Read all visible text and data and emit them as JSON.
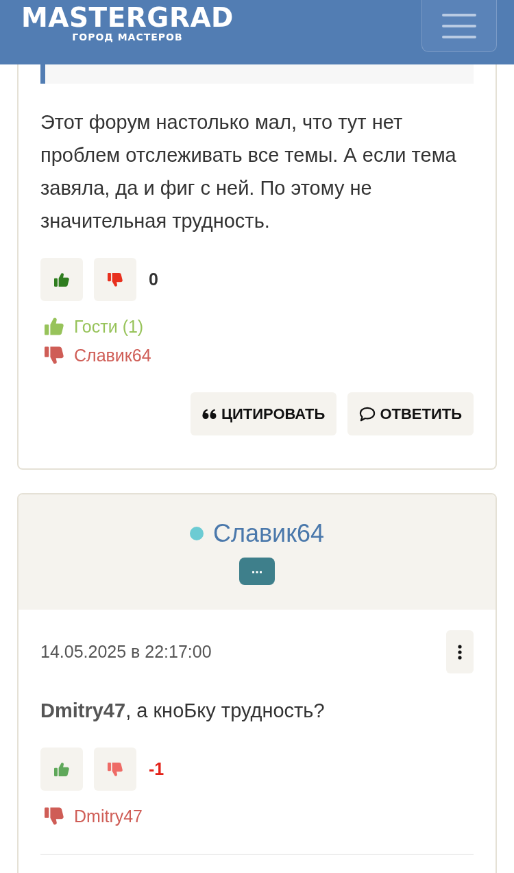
{
  "header": {
    "logo": "MASTERGRAD",
    "tagline": "ГОРОД МАСТЕРОВ"
  },
  "posts": [
    {
      "quote_fragment": true,
      "text": [
        "Этот форум настолько мал, что тут нет проблем отслеживать все темы. А если тема завяла, да и фиг с ней. По этому не значительная трудность."
      ],
      "votes": {
        "strong": true,
        "score": "0",
        "negative": false
      },
      "voters": [
        {
          "kind": "up",
          "name": "Гости (1)"
        },
        {
          "kind": "down",
          "name": "Славик64"
        }
      ],
      "actions": [
        {
          "kind": "quote",
          "label": "ЦИТИРОВАТЬ"
        },
        {
          "kind": "reply",
          "label": "ОТВЕТИТЬ"
        }
      ]
    },
    {
      "quote_fragment": false,
      "author_header": {
        "name": "Славик64",
        "online": true,
        "color": "#6ccbd3",
        "badge": "..."
      },
      "date": "14.05.2025 в 22:17:00",
      "text": [
        "**Dmitry47**, а кноБку трудность?"
      ],
      "votes": {
        "strong": false,
        "score": "-1",
        "negative": true
      },
      "voters": [
        {
          "kind": "down",
          "name": "Dmitry47"
        }
      ]
    }
  ]
}
